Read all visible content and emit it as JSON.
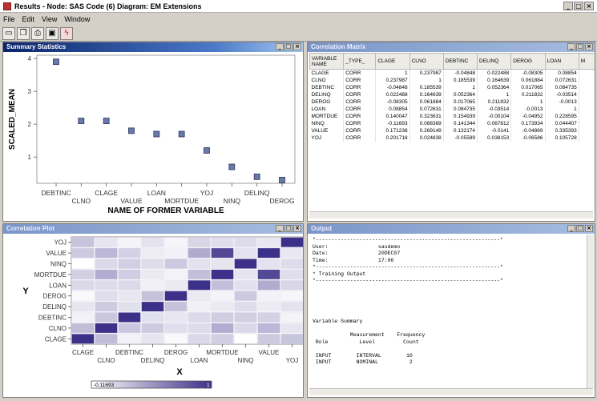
{
  "app": {
    "title": "Results - Node: SAS Code (6) Diagram: EM Extensions",
    "menu": [
      "File",
      "Edit",
      "View",
      "Window"
    ],
    "toolbar_icons": [
      "new-icon",
      "copy-icon",
      "print-icon",
      "save-icon",
      "sas-icon"
    ]
  },
  "panels": {
    "summary": "Summary Statistics",
    "matrix": "Correlation Matrix",
    "corrplot": "Correlation Plot",
    "output": "Output"
  },
  "chart_data": [
    {
      "type": "scatter",
      "title": "",
      "xlabel": "NAME OF FORMER VARIABLE",
      "ylabel": "SCALED_MEAN",
      "categories": [
        "DEBTINC",
        "CLNO",
        "CLAGE",
        "VALUE",
        "LOAN",
        "MORTDUE",
        "YOJ",
        "NINQ",
        "DELINQ",
        "DEROG"
      ],
      "values": [
        3.9,
        2.1,
        2.1,
        1.8,
        1.7,
        1.7,
        1.2,
        0.7,
        0.4,
        0.3
      ],
      "yticks": [
        1,
        2,
        3,
        4
      ],
      "ylim": [
        0.2,
        4.1
      ],
      "marker_color": "#6a7aa8",
      "grid": false
    },
    {
      "type": "heatmap",
      "xlabel": "X",
      "ylabel": "Y",
      "variables": [
        "CLAGE",
        "CLNO",
        "DEBTINC",
        "DELINQ",
        "DEROG",
        "LOAN",
        "MORTDUE",
        "NINQ",
        "VALUE",
        "YOJ"
      ],
      "scale_min_label": "-0.11693",
      "scale_max_label": "1",
      "scale_min": -0.11693,
      "scale_max": 1,
      "low_color": "#ffffff",
      "high_color": "#3c3088",
      "matrix": [
        [
          1,
          0.237987,
          -0.04848,
          0.022488,
          -0.08305,
          0.08854,
          0.140047,
          -0.11693,
          0.171238,
          0.201718
        ],
        [
          0.237987,
          1,
          0.185539,
          0.164639,
          0.061884,
          0.072631,
          0.323631,
          0.088369,
          0.269149,
          0.024838
        ],
        [
          -0.04848,
          0.185539,
          1,
          0.052364,
          0.017065,
          0.084735,
          0.154939,
          0.141344,
          0.132174,
          -0.05589
        ],
        [
          0.022488,
          0.164639,
          0.052364,
          1,
          0.211832,
          -0.03514,
          -0.00104,
          0.067812,
          -0.0141,
          0.038153
        ],
        [
          -0.08305,
          0.061884,
          0.017065,
          0.211832,
          1,
          -0.0013,
          -0.04952,
          0.173934,
          -0.04869,
          -0.06586
        ],
        [
          0.08854,
          0.072631,
          0.084735,
          -0.03514,
          -0.0013,
          1,
          0.228595,
          0.044407,
          0.335393,
          0.105728
        ],
        [
          0.140047,
          0.323631,
          0.154939,
          -0.00104,
          -0.04952,
          0.228595,
          1,
          0.03,
          0.87,
          0.06
        ],
        [
          -0.11693,
          0.088369,
          0.141344,
          0.067812,
          0.173934,
          0.044407,
          0.03,
          1,
          0.04,
          0.07
        ],
        [
          0.171238,
          0.269149,
          0.132174,
          -0.0141,
          -0.04869,
          0.335393,
          0.87,
          0.04,
          1,
          0.01
        ],
        [
          0.201718,
          0.024838,
          -0.05589,
          0.038153,
          -0.06586,
          0.105728,
          0.06,
          0.07,
          0.01,
          1
        ]
      ]
    }
  ],
  "matrix": {
    "columns": [
      "VARIABLE NAME",
      "_TYPE_",
      "CLAGE",
      "CLNO",
      "DEBTINC",
      "DELINQ",
      "DEROG",
      "LOAN",
      "M"
    ],
    "rows": [
      [
        "CLAGE",
        "CORR",
        "1",
        "0.237987",
        "-0.04848",
        "0.022488",
        "-0.08305",
        "0.08854"
      ],
      [
        "CLNO",
        "CORR",
        "0.237987",
        "1",
        "0.185539",
        "0.164639",
        "0.061884",
        "0.072631"
      ],
      [
        "DEBTINC",
        "CORR",
        "-0.04848",
        "0.185539",
        "1",
        "0.052364",
        "0.017065",
        "0.084735"
      ],
      [
        "DELINQ",
        "CORR",
        "0.022488",
        "0.164639",
        "0.052364",
        "1",
        "0.211832",
        "-0.03514"
      ],
      [
        "DEROG",
        "CORR",
        "-0.08305",
        "0.061884",
        "0.017065",
        "0.211832",
        "1",
        "-0.0013"
      ],
      [
        "LOAN",
        "CORR",
        "0.08854",
        "0.072631",
        "0.084735",
        "-0.03514",
        "-0.0013",
        "1"
      ],
      [
        "MORTDUE",
        "CORR",
        "0.140047",
        "0.323631",
        "0.154939",
        "-0.00104",
        "-0.04952",
        "0.228595"
      ],
      [
        "NINQ",
        "CORR",
        "-0.11693",
        "0.088369",
        "0.141344",
        "0.067812",
        "0.173934",
        "0.044407"
      ],
      [
        "VALUE",
        "CORR",
        "0.171238",
        "0.269149",
        "0.132174",
        "-0.0141",
        "-0.04869",
        "0.335393"
      ],
      [
        "YOJ",
        "CORR",
        "0.201718",
        "0.024838",
        "-0.05589",
        "0.038153",
        "-0.06586",
        "0.105728"
      ]
    ]
  },
  "output": {
    "lines": [
      "*-----------------------------------------------------------*",
      "User:                sasdemo",
      "Date:                20DEC07",
      "Time:                17:06",
      "*-----------------------------------------------------------*",
      "* Training Output",
      "*-----------------------------------------------------------*",
      "",
      "",
      "",
      "",
      "",
      "Variable Summary",
      "",
      "            Measurement    Frequency",
      " Role          Level         Count",
      "",
      " INPUT        INTERVAL        10",
      " INPUT        NOMINAL          2"
    ]
  }
}
